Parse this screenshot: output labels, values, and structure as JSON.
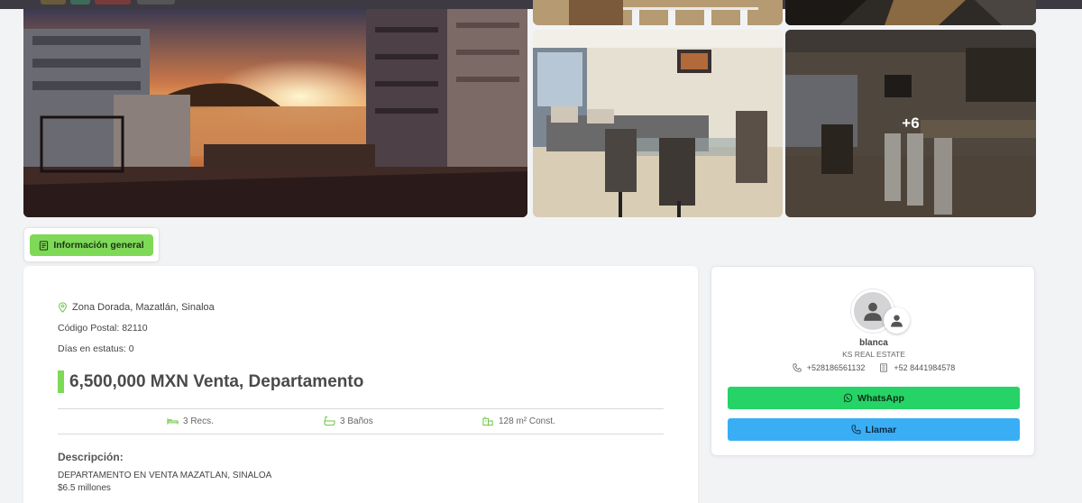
{
  "gallery": {
    "more_count": "+6"
  },
  "tabs": {
    "general_label": "Información general"
  },
  "property": {
    "location": "Zona Dorada, Mazatlán, Sinaloa",
    "postal_label": "Código Postal:",
    "postal_value": "82110",
    "days_label": "Días en estatus:",
    "days_value": "0",
    "price_line": "6,500,000 MXN Venta, Departamento",
    "rooms": "3 Recs.",
    "baths": "3 Baños",
    "construction": "128 m² Const.",
    "description_title": "Descripción:",
    "description_line1": "DEPARTAMENTO EN VENTA MAZATLAN, SINALOA",
    "description_line2": "$6.5 millones"
  },
  "agent": {
    "name": "blanca",
    "agency": "KS REAL ESTATE",
    "phone_1": "+528186561132",
    "phone_2": "+52 8441984578",
    "whatsapp_label": "WhatsApp",
    "call_label": "Llamar"
  },
  "colors": {
    "accent_green": "#7ed957",
    "whatsapp_green": "#25d366",
    "call_blue": "#3aaef5"
  }
}
